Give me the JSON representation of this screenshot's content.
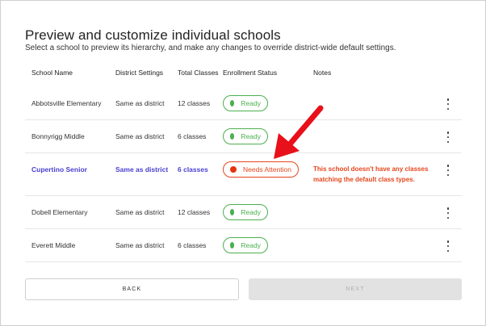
{
  "page": {
    "title": "Preview and customize individual schools",
    "subtitle": "Select a school to preview its hierarchy, and make any changes to override district-wide default settings."
  },
  "table": {
    "headers": [
      "School Name",
      "District Settings",
      "Total Classes",
      "Enrollment Status",
      "Notes"
    ],
    "rows": [
      {
        "name": "Abbotsville Elementary",
        "settings": "Same as district",
        "classes": "12 classes",
        "status": "Ready",
        "note1": "",
        "note2": ""
      },
      {
        "name": "Bonnyrigg Middle",
        "settings": "Same as district",
        "classes": "6 classes",
        "status": "Ready",
        "note1": "",
        "note2": ""
      },
      {
        "name": "Cupertino Senior",
        "settings": "Same as district",
        "classes": "6 classes",
        "status": "Needs Attention",
        "note1": "This school doesn't have any classes",
        "note2": "matching the default class types."
      },
      {
        "name": "Dobell Elementary",
        "settings": "Same as district",
        "classes": "12 classes",
        "status": "Ready",
        "note1": "",
        "note2": ""
      },
      {
        "name": "Everett Middle",
        "settings": "Same as district",
        "classes": "6 classes",
        "status": "Ready",
        "note1": "",
        "note2": ""
      }
    ]
  },
  "buttons": {
    "back": "BACK",
    "next": "NEXT"
  },
  "colors": {
    "ready": "#4caf50",
    "attention": "#e5461d",
    "link": "#4a3fd0",
    "arrow": "#e8101a"
  },
  "icons": {
    "row_menu": "more-vertical-icon",
    "status_dot": "status-dot-icon",
    "annotation": "red-arrow-icon"
  }
}
